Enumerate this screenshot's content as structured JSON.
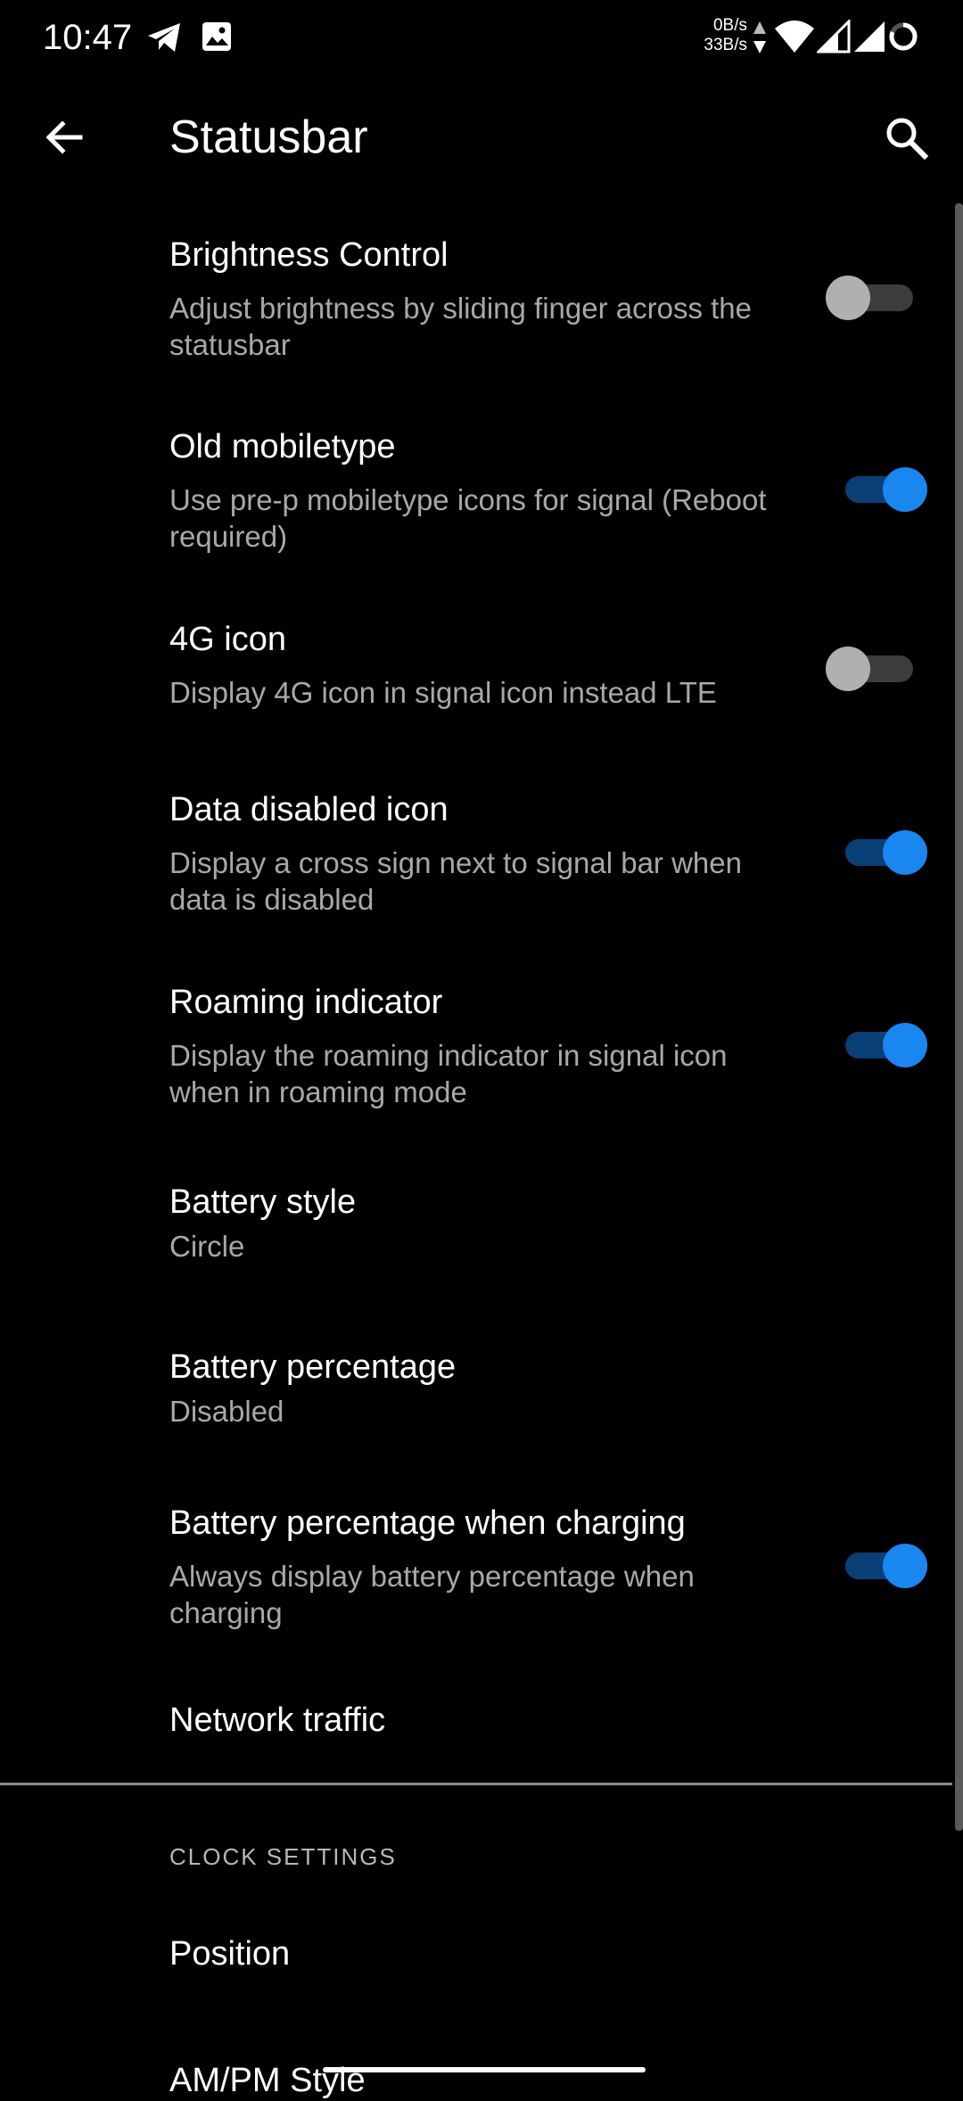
{
  "status_bar": {
    "time": "10:47",
    "net_down": "0B/s",
    "net_up": "33B/s",
    "icons": [
      "telegram-icon",
      "gallery-icon",
      "data-activity-icon",
      "wifi-icon",
      "signal-icon",
      "signal-icon",
      "battery-circle-icon"
    ]
  },
  "toolbar": {
    "title": "Statusbar",
    "back_icon": "arrow-back-icon",
    "search_icon": "search-icon"
  },
  "settings": [
    {
      "title": "Brightness Control",
      "summary": "Adjust brightness by sliding finger across the statusbar",
      "toggle": false
    },
    {
      "title": "Old mobiletype",
      "summary": "Use pre-p mobiletype icons for signal (Reboot required)",
      "toggle": true
    },
    {
      "title": "4G icon",
      "summary": "Display 4G icon in signal icon instead LTE",
      "toggle": false
    },
    {
      "title": "Data disabled icon",
      "summary": "Display a cross sign next to signal bar when data is disabled",
      "toggle": true
    },
    {
      "title": "Roaming indicator",
      "summary": "Display the roaming indicator in signal icon when in roaming mode",
      "toggle": true
    },
    {
      "title": "Battery style",
      "summary": "Circle"
    },
    {
      "title": "Battery percentage",
      "summary": "Disabled"
    },
    {
      "title": "Battery percentage when charging",
      "summary": "Always display battery percentage when charging",
      "toggle": true
    },
    {
      "title": "Network traffic"
    }
  ],
  "clock_section": {
    "header": "CLOCK SETTINGS",
    "items": [
      {
        "title": "Position"
      },
      {
        "title": "AM/PM Style"
      }
    ]
  },
  "colors": {
    "background": "#000000",
    "accent": "#1a86f0",
    "switch_track_on": "#0a3f75",
    "switch_thumb_off": "#b0b0b0",
    "summary_text": "#a8a8a8"
  }
}
